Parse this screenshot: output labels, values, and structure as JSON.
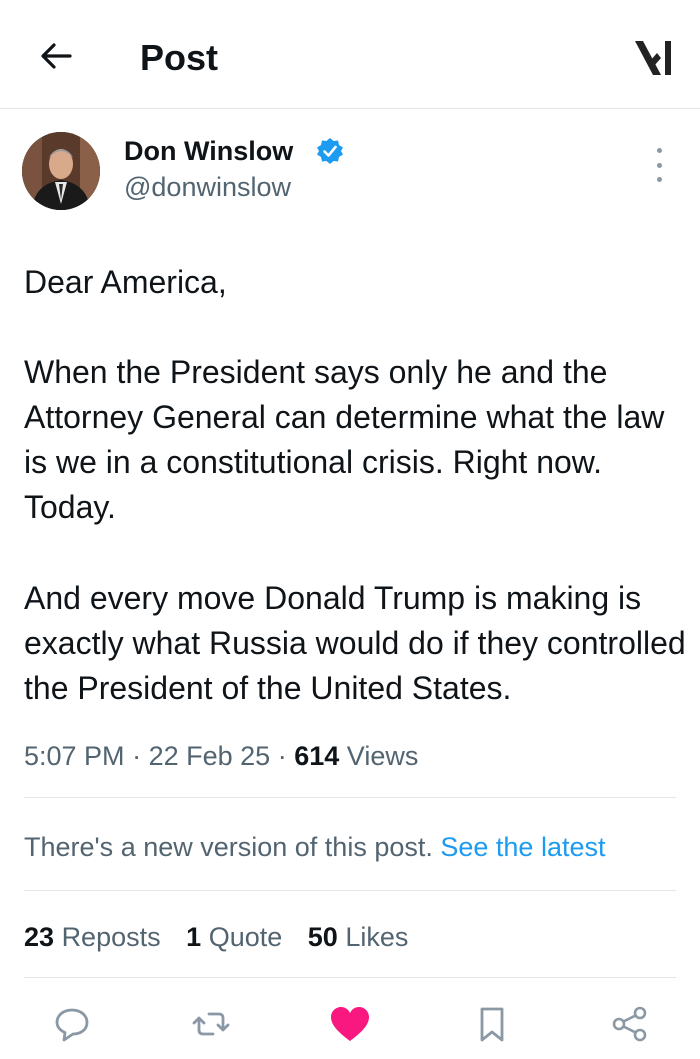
{
  "header": {
    "title": "Post"
  },
  "author": {
    "name": "Don Winslow",
    "handle": "@donwinslow",
    "verified": true
  },
  "post": {
    "paragraphs": [
      "Dear America,",
      "When the President says only he and the Attorney General can determine what the law is we in a constitutional crisis. Right now. Today.",
      "And every move Donald Trump is making is exactly what Russia would do if they controlled the President of the United States."
    ],
    "time": "5:07 PM",
    "date": "22 Feb 25",
    "views_count": "614",
    "views_label": "Views",
    "separator": "·"
  },
  "notice": {
    "text": "There's a new version of this post.",
    "link": "See the latest"
  },
  "stats": {
    "reposts_count": "23",
    "reposts_label": "Reposts",
    "quotes_count": "1",
    "quotes_label": "Quote",
    "likes_count": "50",
    "likes_label": "Likes"
  },
  "actions": [
    "reply-icon",
    "repost-icon",
    "like-icon",
    "bookmark-icon",
    "share-icon"
  ],
  "colors": {
    "accent": "#1d9bf0",
    "like": "#f91880",
    "muted": "#536471",
    "icon": "#8b98a5"
  }
}
